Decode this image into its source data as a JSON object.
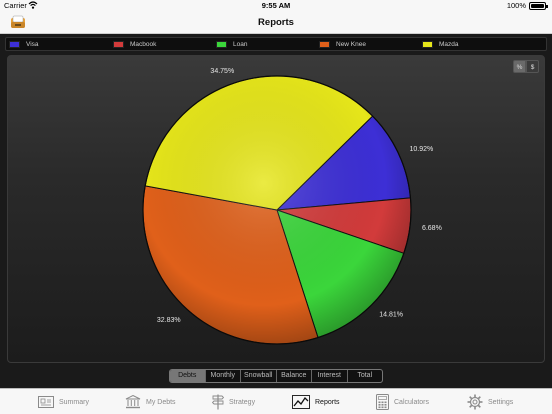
{
  "status": {
    "carrier": "Carrier",
    "time": "9:55 AM",
    "battery": "100%"
  },
  "nav": {
    "title": "Reports"
  },
  "legend": [
    {
      "label": "Visa",
      "color": "#3d2fd6"
    },
    {
      "label": "Macbook",
      "color": "#d23b3b"
    },
    {
      "label": "Loan",
      "color": "#3bd63b"
    },
    {
      "label": "New Knee",
      "color": "#e0601a"
    },
    {
      "label": "Mazda",
      "color": "#e6e61a"
    }
  ],
  "toggles": {
    "percent": "%",
    "dollar": "$"
  },
  "chart_data": {
    "type": "pie",
    "slices": [
      {
        "name": "Visa",
        "value": 10.92,
        "label": "10.92%",
        "color": "#3d2fd6"
      },
      {
        "name": "Macbook",
        "value": 6.68,
        "label": "6.68%",
        "color": "#d23b3b"
      },
      {
        "name": "Loan",
        "value": 14.81,
        "label": "14.81%",
        "color": "#3bd63b"
      },
      {
        "name": "New Knee",
        "value": 32.83,
        "label": "32.83%",
        "color": "#e0601a"
      },
      {
        "name": "Mazda",
        "value": 34.75,
        "label": "34.75%",
        "color": "#e6e61a"
      }
    ]
  },
  "segments": {
    "items": [
      "Debts",
      "Monthly",
      "Snowball",
      "Balance",
      "Interest",
      "Total"
    ],
    "selected": "Debts"
  },
  "tabs": [
    {
      "label": "Summary",
      "icon": "summary-icon"
    },
    {
      "label": "My Debts",
      "icon": "bank-icon"
    },
    {
      "label": "Strategy",
      "icon": "signpost-icon"
    },
    {
      "label": "Reports",
      "icon": "chart-icon",
      "active": true
    },
    {
      "label": "Calculators",
      "icon": "calculator-icon"
    },
    {
      "label": "Settings",
      "icon": "gear-icon"
    }
  ]
}
